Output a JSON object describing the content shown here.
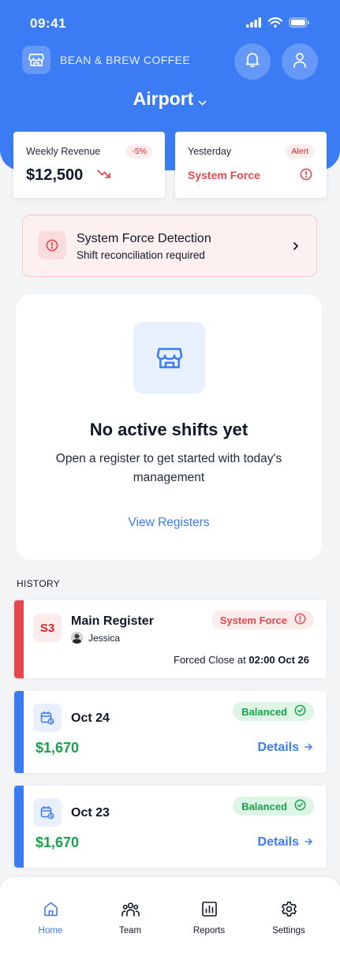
{
  "status_bar": {
    "time": "09:41",
    "icons": [
      "signal-icon",
      "wifi-icon",
      "battery-icon"
    ]
  },
  "header": {
    "brand_name": "BEAN & BREW COFFEE",
    "location": "Airport",
    "icons": {
      "brand": "store-icon",
      "notifications": "bell-icon",
      "profile": "user-icon"
    }
  },
  "stats": [
    {
      "label": "Weekly Revenue",
      "badge": "-5%",
      "value": "$12,500",
      "trend_icon": "trending-down-icon"
    },
    {
      "label": "Yesterday",
      "badge": "Alert",
      "value": "System Force",
      "icon": "alert-circle-icon"
    }
  ],
  "alert_banner": {
    "title": "System Force Detection",
    "subtitle": "Shift reconciliation required"
  },
  "empty_state": {
    "title": "No active shifts yet",
    "subtitle": "Open a register to get started with today's management",
    "link": "View Registers"
  },
  "history": {
    "label": "HISTORY",
    "forced": {
      "badge": "S3",
      "title": "Main Register",
      "person": "Jessica",
      "status": "System Force",
      "forced_prefix": "Forced Close at",
      "forced_time": "02:00 Oct 26"
    },
    "items": [
      {
        "date": "Oct 24",
        "status": "Balanced",
        "amount": "$1,670",
        "details_label": "Details"
      },
      {
        "date": "Oct 23",
        "status": "Balanced",
        "amount": "$1,670",
        "details_label": "Details"
      }
    ]
  },
  "nav": [
    {
      "label": "Home",
      "icon": "home-icon",
      "active": true
    },
    {
      "label": "Team",
      "icon": "team-icon",
      "active": false
    },
    {
      "label": "Reports",
      "icon": "reports-icon",
      "active": false
    },
    {
      "label": "Settings",
      "icon": "settings-icon",
      "active": false
    }
  ],
  "colors": {
    "primary": "#3b7cf5",
    "danger": "#e5484d",
    "success": "#16a34a",
    "background": "#f3f4f6"
  }
}
